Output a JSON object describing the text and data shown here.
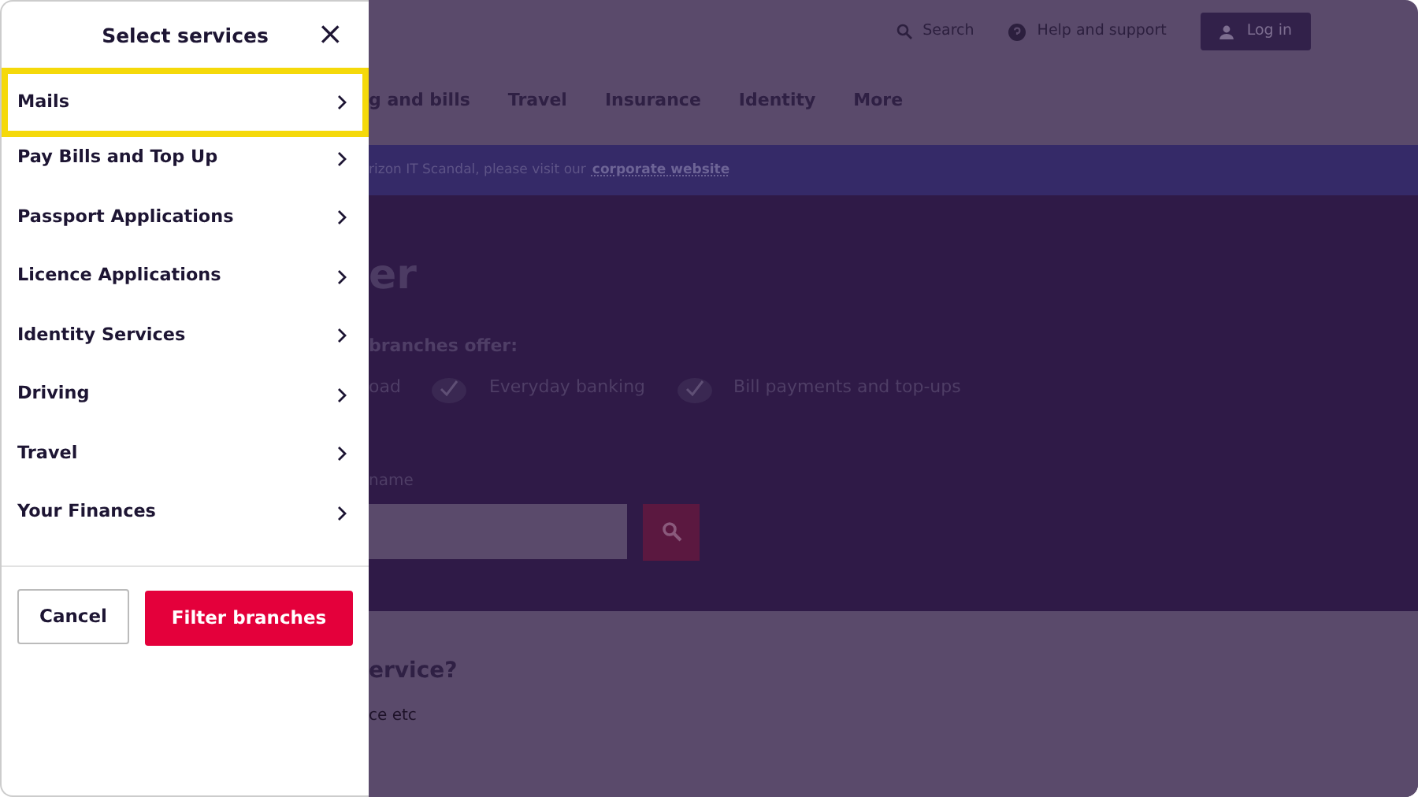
{
  "drawer": {
    "title": "Select services",
    "close": "×",
    "items": [
      {
        "label": "Mails",
        "selected": true
      },
      {
        "label": "Pay Bills and Top Up",
        "selected": false
      },
      {
        "label": "Passport Applications",
        "selected": false
      },
      {
        "label": "Licence Applications",
        "selected": false
      },
      {
        "label": "Identity Services",
        "selected": false
      },
      {
        "label": "Driving",
        "selected": false
      },
      {
        "label": "Travel",
        "selected": false
      },
      {
        "label": "Your Finances",
        "selected": false
      }
    ],
    "buttons": [
      {
        "label": "Cancel",
        "kind": "secondary"
      },
      {
        "label": "Filter branches",
        "kind": "primary"
      }
    ]
  },
  "page": {
    "top_links": [
      "Search",
      "Help and support"
    ],
    "login": "Log in",
    "nav": [
      "g and bills",
      "Travel",
      "Insurance",
      "Identity",
      "More"
    ],
    "banner": {
      "text": "rizon IT Scandal, please visit our",
      "link": "corporate website"
    },
    "hero": {
      "title": "er",
      "subtitle": "branches offer:",
      "features": [
        {
          "label": "oad",
          "tick": false
        },
        {
          "label": "Everyday banking",
          "tick": true
        },
        {
          "label": "Bill payments and top-ups",
          "tick": true
        }
      ],
      "field_label": "name"
    },
    "section": {
      "title": "ervice?",
      "text": "ce etc"
    }
  }
}
